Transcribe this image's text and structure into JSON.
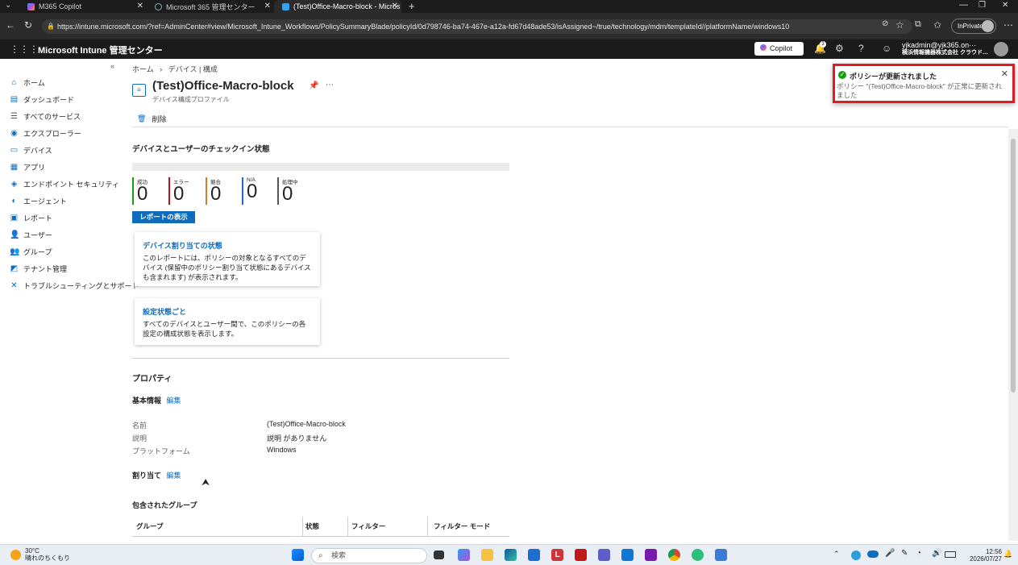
{
  "browser": {
    "tabs": [
      {
        "label": "M365 Copilot"
      },
      {
        "label": "Microsoft 365 管理センター"
      },
      {
        "label": "(Test)Office-Macro-block - Micros"
      }
    ],
    "url": "https://intune.microsoft.com/?ref=AdminCenter#view/Microsoft_Intune_Workflows/PolicySummaryBlade/policyId/0d798746-ba74-467e-a12a-fd67d48ade53/isAssigned~/true/technology/mdm/templateId//platformName/windows10",
    "inprivate": "InPrivate"
  },
  "portal": {
    "title": "Microsoft Intune 管理センター",
    "copilot": "Copilot",
    "notification_count": "3",
    "account_name": "yjkadmin@yjk365.on···",
    "account_org": "横浜情報機器株式会社 クラウド…"
  },
  "sidebar": {
    "items": [
      {
        "label": "ホーム",
        "icon": "home-icon"
      },
      {
        "label": "ダッシュボード",
        "icon": "dashboard-icon"
      },
      {
        "label": "すべてのサービス",
        "icon": "list-icon"
      },
      {
        "label": "エクスプローラー",
        "icon": "explorer-icon"
      },
      {
        "label": "デバイス",
        "icon": "devices-icon"
      },
      {
        "label": "アプリ",
        "icon": "apps-icon"
      },
      {
        "label": "エンドポイント セキュリティ",
        "icon": "endpoint-security-icon"
      },
      {
        "label": "エージェント",
        "icon": "agent-icon"
      },
      {
        "label": "レポート",
        "icon": "reports-icon"
      },
      {
        "label": "ユーザー",
        "icon": "users-icon"
      },
      {
        "label": "グループ",
        "icon": "groups-icon"
      },
      {
        "label": "テナント管理",
        "icon": "tenant-icon"
      },
      {
        "label": "トラブルシューティングとサポート",
        "icon": "troubleshoot-icon"
      }
    ]
  },
  "breadcrumb": {
    "home": "ホーム",
    "sep": "›",
    "current": "デバイス | 構成"
  },
  "page": {
    "title": "(Test)Office-Macro-block",
    "subtitle": "デバイス構成プロファイル",
    "delete": "削除",
    "checkin_heading": "デバイスとユーザーのチェックイン状態",
    "stats": [
      {
        "label": "成功",
        "value": "0",
        "color": "#13a10e"
      },
      {
        "label": "エラー",
        "value": "0",
        "color": "#c50f1f"
      },
      {
        "label": "競合",
        "value": "0",
        "color": "#d67a2c"
      },
      {
        "label": "N/A",
        "value": "0",
        "color": "#2266d6"
      },
      {
        "label": "処理中",
        "value": "0",
        "color": "#555555"
      }
    ],
    "view_report": "レポートの表示",
    "cards": [
      {
        "title": "デバイス割り当ての状態",
        "desc": "このレポートには、ポリシーの対象となるすべてのデバイス (保留中のポリシー割り当て状態にあるデバイスも含まれます) が表示されます。"
      },
      {
        "title": "設定状態ごと",
        "desc": "すべてのデバイスとユーザー間で、このポリシーの各設定の構成状態を表示します。"
      }
    ],
    "properties_heading": "プロパティ",
    "basics_heading": "基本情報",
    "edit": "編集",
    "props": [
      {
        "key": "名前",
        "value": "(Test)Office-Macro-block"
      },
      {
        "key": "説明",
        "value": "説明 がありません"
      },
      {
        "key": "プラットフォーム",
        "value": "Windows"
      }
    ],
    "assignments_heading": "割り当て",
    "included_groups": "包含されたグループ",
    "table_headers": [
      "グループ",
      "状態",
      "フィルター",
      "フィルター モード"
    ]
  },
  "toast": {
    "title": "ポリシーが更新されました",
    "body": "ポリシー \"(Test)Office-Macro-block\" が正常に更新されました"
  },
  "taskbar": {
    "temp": "30°C",
    "weather": "晴れのちくもり",
    "search": "検索",
    "time": "12:56",
    "date": "2026/07/27"
  }
}
